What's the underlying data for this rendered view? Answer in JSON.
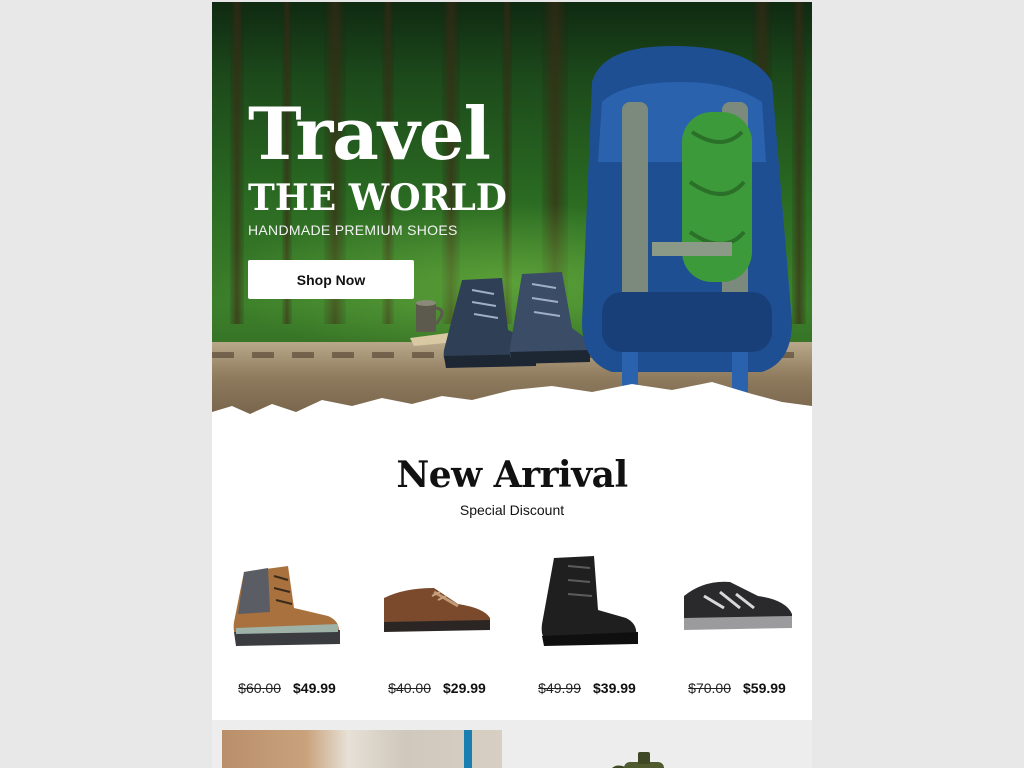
{
  "hero": {
    "title": "Travel",
    "subtitle": "THE WORLD",
    "tagline": "HANDMADE PREMIUM SHOES",
    "cta_label": "Shop Now"
  },
  "new_arrival": {
    "title": "New Arrival",
    "subtitle": "Special Discount",
    "products": [
      {
        "image": "brown-hiking-boot",
        "old_price": "$60.00",
        "new_price": "$49.99"
      },
      {
        "image": "brown-leather-shoe",
        "old_price": "$40.00",
        "new_price": "$29.99"
      },
      {
        "image": "black-combat-boot",
        "old_price": "$49.99",
        "new_price": "$39.99"
      },
      {
        "image": "black-trail-sneaker",
        "old_price": "$70.00",
        "new_price": "$59.99"
      }
    ]
  },
  "colors": {
    "page_background": "#e8e8e8",
    "card_background": "#ffffff",
    "text": "#111111",
    "forest_green": "#2a6a22",
    "backpack_blue": "#1e4f93"
  }
}
